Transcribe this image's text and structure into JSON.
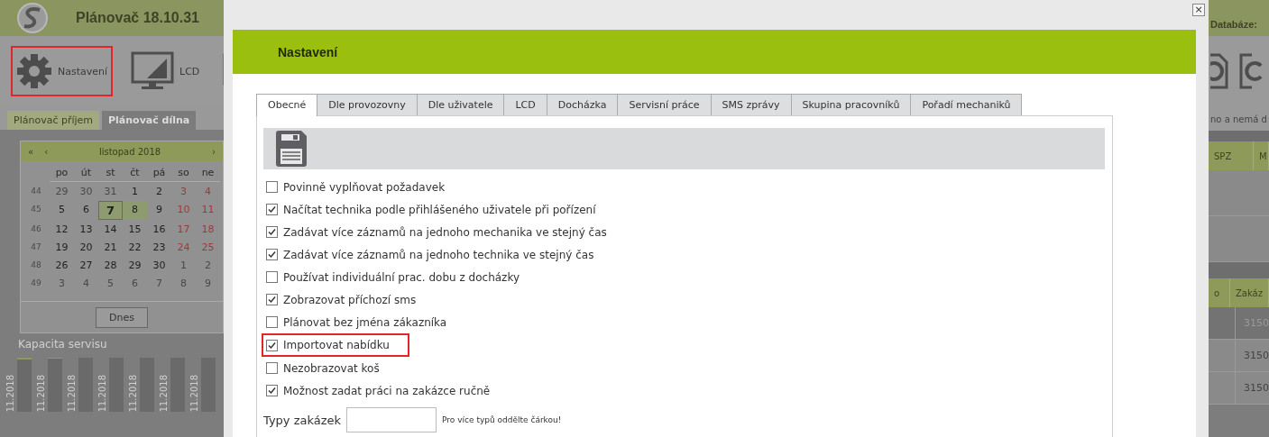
{
  "background_app": {
    "title": "Plánovač 18.10.31",
    "toolbar": [
      {
        "kind": "gear",
        "label": "Nastavení",
        "highlighted": true
      },
      {
        "kind": "monitor",
        "label": "LCD",
        "highlighted": false
      },
      {
        "kind": "frame",
        "highlighted": false
      }
    ],
    "tabs": [
      {
        "label": "Plánovač příjem",
        "selected": false
      },
      {
        "label": "Plánovač dílna",
        "selected": true
      }
    ],
    "calendar": {
      "prev_year": "«",
      "prev": "‹",
      "month": "listopad 2018",
      "next": "›",
      "weekdays": [
        "po",
        "út",
        "st",
        "čt",
        "pá",
        "so",
        "ne"
      ],
      "weeks": [
        {
          "number": "44",
          "days": [
            {
              "text": "29",
              "kind": "other"
            },
            {
              "text": "30",
              "kind": "other"
            },
            {
              "text": "31",
              "kind": "other"
            },
            {
              "text": "1",
              "kind": "day"
            },
            {
              "text": "2",
              "kind": "day"
            },
            {
              "text": "3",
              "kind": "weekend"
            },
            {
              "text": "4",
              "kind": "weekend"
            }
          ]
        },
        {
          "number": "45",
          "days": [
            {
              "text": "5",
              "kind": "day"
            },
            {
              "text": "6",
              "kind": "day"
            },
            {
              "text": "7",
              "kind": "today"
            },
            {
              "text": "8",
              "kind": "selected"
            },
            {
              "text": "9",
              "kind": "day"
            },
            {
              "text": "10",
              "kind": "weekend"
            },
            {
              "text": "11",
              "kind": "weekend"
            }
          ]
        },
        {
          "number": "46",
          "days": [
            {
              "text": "12",
              "kind": "day"
            },
            {
              "text": "13",
              "kind": "day"
            },
            {
              "text": "14",
              "kind": "day"
            },
            {
              "text": "15",
              "kind": "day"
            },
            {
              "text": "16",
              "kind": "day"
            },
            {
              "text": "17",
              "kind": "weekend"
            },
            {
              "text": "18",
              "kind": "weekend"
            }
          ]
        },
        {
          "number": "47",
          "days": [
            {
              "text": "19",
              "kind": "day"
            },
            {
              "text": "20",
              "kind": "day"
            },
            {
              "text": "21",
              "kind": "day"
            },
            {
              "text": "22",
              "kind": "day"
            },
            {
              "text": "23",
              "kind": "day"
            },
            {
              "text": "24",
              "kind": "weekend"
            },
            {
              "text": "25",
              "kind": "weekend"
            }
          ]
        },
        {
          "number": "48",
          "days": [
            {
              "text": "26",
              "kind": "day"
            },
            {
              "text": "27",
              "kind": "day"
            },
            {
              "text": "28",
              "kind": "day"
            },
            {
              "text": "29",
              "kind": "day"
            },
            {
              "text": "30",
              "kind": "day"
            },
            {
              "text": "1",
              "kind": "other"
            },
            {
              "text": "2",
              "kind": "other"
            }
          ]
        },
        {
          "number": "49",
          "days": [
            {
              "text": "3",
              "kind": "other"
            },
            {
              "text": "4",
              "kind": "other"
            },
            {
              "text": "5",
              "kind": "other"
            },
            {
              "text": "6",
              "kind": "other"
            },
            {
              "text": "7",
              "kind": "other"
            },
            {
              "text": "8",
              "kind": "other"
            },
            {
              "text": "9",
              "kind": "other"
            }
          ]
        }
      ],
      "today_button": "Dnes"
    },
    "capacity": {
      "title": "Kapacita servisu",
      "bars": [
        {
          "label": "11.2018",
          "level": 0.04
        },
        {
          "label": "11.2018",
          "level": 0.01
        },
        {
          "label": "11.2018"
        },
        {
          "label": "11.2018"
        },
        {
          "label": "11.2018"
        },
        {
          "label": "11.2018"
        },
        {
          "label": "11.2018"
        }
      ]
    },
    "database_label": "Databáze:",
    "notice": "no a nemá d",
    "table_1": {
      "columns": [
        "SPZ",
        "M"
      ]
    },
    "table_2": {
      "columns": [
        "o",
        "Zakáz"
      ],
      "rows": [
        "3150",
        "3150",
        "3150"
      ]
    }
  },
  "dialog": {
    "close": "×",
    "title": "Nastavení",
    "tabs": [
      {
        "label": "Obecné",
        "selected": true
      },
      {
        "label": "Dle provozovny",
        "selected": false
      },
      {
        "label": "Dle uživatele",
        "selected": false
      },
      {
        "label": "LCD",
        "selected": false
      },
      {
        "label": "Docházka",
        "selected": false
      },
      {
        "label": "Servisní práce",
        "selected": false
      },
      {
        "label": "SMS zprávy",
        "selected": false
      },
      {
        "label": "Skupina pracovníků",
        "selected": false
      },
      {
        "label": "Pořadí mechaniků",
        "selected": false
      }
    ],
    "options": [
      {
        "label": "Povinně vyplňovat požadavek",
        "checked": false,
        "highlighted": false
      },
      {
        "label": "Načítat technika podle přihlášeného uživatele při pořízení",
        "checked": true,
        "highlighted": false
      },
      {
        "label": "Zadávat více záznamů na jednoho mechanika ve stejný čas",
        "checked": true,
        "highlighted": false
      },
      {
        "label": "Zadávat více záznamů na jednoho technika ve stejný čas",
        "checked": true,
        "highlighted": false
      },
      {
        "label": "Používat individuální prac. dobu z docházky",
        "checked": false,
        "highlighted": false
      },
      {
        "label": "Zobrazovat příchozí sms",
        "checked": true,
        "highlighted": false
      },
      {
        "label": "Plánovat bez jména zákazníka",
        "checked": false,
        "highlighted": false
      },
      {
        "label": "Importovat nabídku",
        "checked": true,
        "highlighted": true
      },
      {
        "label": "Nezobrazovat koš",
        "checked": false,
        "highlighted": false
      },
      {
        "label": "Možnost zadat práci na zakázce ručně",
        "checked": true,
        "highlighted": false
      }
    ],
    "order_types": {
      "label": "Typy zakázek",
      "hint": "Pro více typů oddělte čárkou!"
    }
  }
}
